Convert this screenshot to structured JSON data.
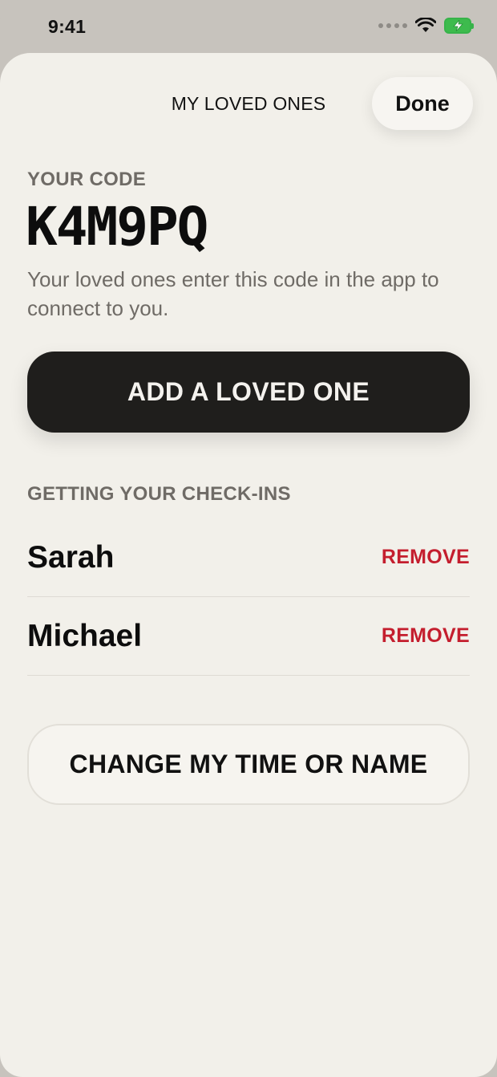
{
  "status_bar": {
    "time": "9:41"
  },
  "sheet": {
    "title": "MY LOVED ONES",
    "done_label": "Done"
  },
  "code": {
    "label": "YOUR CODE",
    "value": "K4M9PQ",
    "help_text": "Your loved ones enter this code in the app to connect to you."
  },
  "add_button_label": "ADD A LOVED ONE",
  "checkins": {
    "label": "GETTING YOUR CHECK-INS",
    "people": [
      {
        "name": "Sarah",
        "action": "REMOVE"
      },
      {
        "name": "Michael",
        "action": "REMOVE"
      }
    ]
  },
  "change_button_label": "CHANGE MY TIME OR NAME",
  "colors": {
    "remove": "#c41e2e",
    "primary_button": "#1f1e1c",
    "background": "#f2f0ea",
    "battery": "#3dbb4d"
  }
}
